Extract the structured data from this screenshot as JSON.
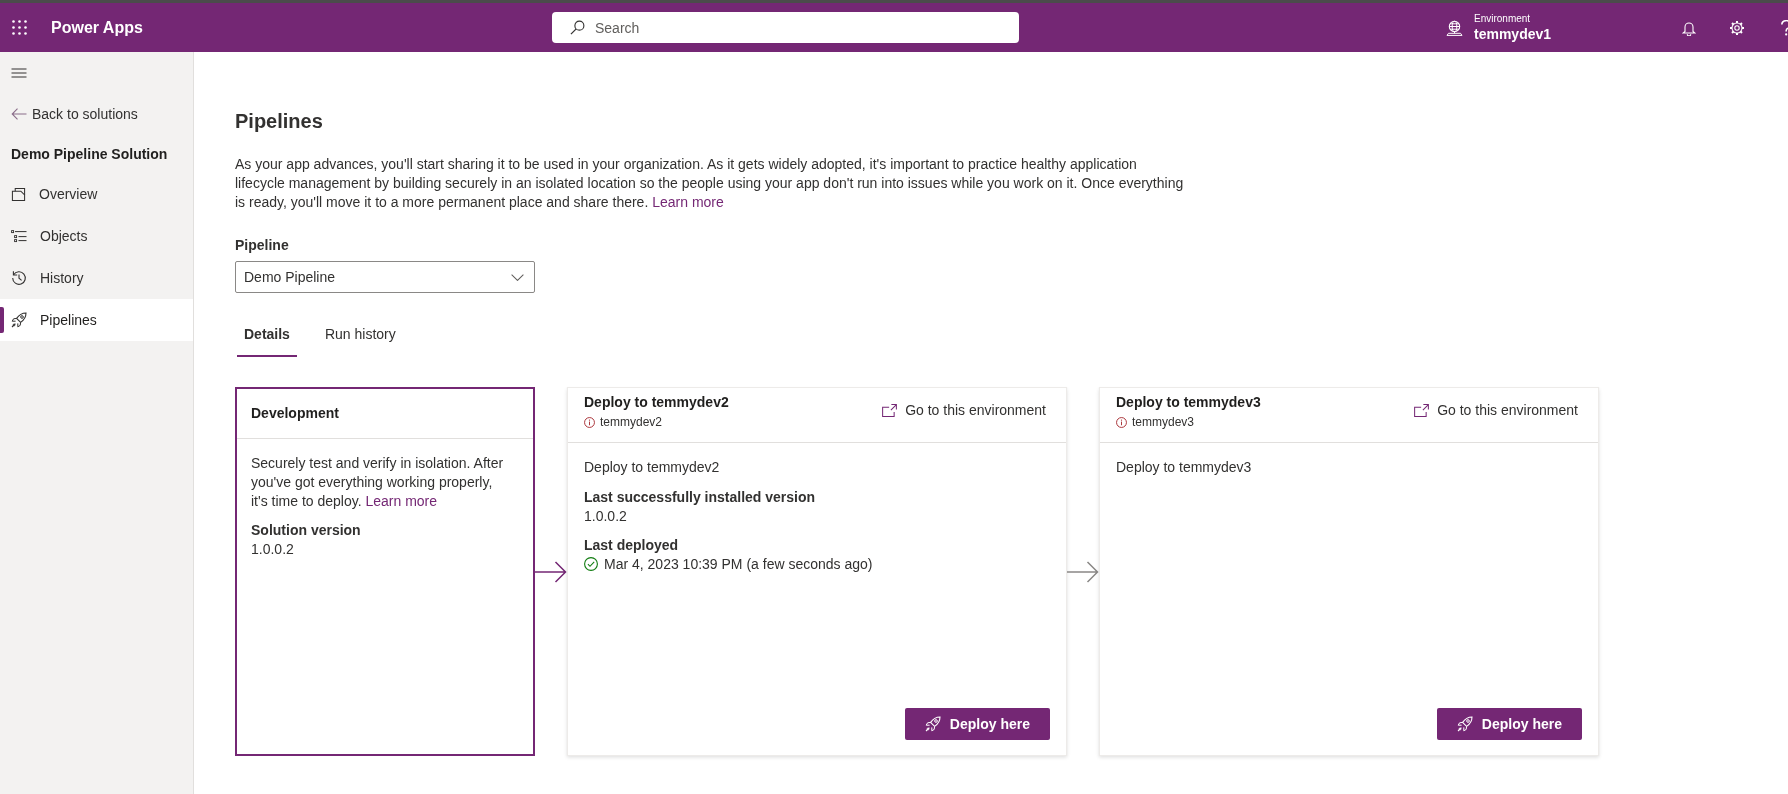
{
  "top_bar": {
    "app_name": "Power Apps",
    "search": {
      "placeholder": "Search"
    },
    "environment": {
      "label": "Environment",
      "name": "temmydev1"
    }
  },
  "sidebar": {
    "back": "Back to solutions",
    "solution_name": "Demo Pipeline Solution",
    "items": [
      {
        "label": "Overview",
        "selected": false
      },
      {
        "label": "Objects",
        "selected": false
      },
      {
        "label": "History",
        "selected": false
      },
      {
        "label": "Pipelines",
        "selected": true
      }
    ]
  },
  "page": {
    "title": "Pipelines",
    "description": {
      "text": "As your app advances, you'll start sharing it to be used in your organization. As it gets widely adopted, it's important to practice healthy application lifecycle management by building securely in an isolated location so the people using your app don't run into issues while you work on it. Once everything is ready, you'll move it to a more permanent place and share there.",
      "link": "Learn more"
    },
    "pipeline": {
      "label": "Pipeline",
      "value": "Demo Pipeline"
    },
    "tabs": [
      {
        "label": "Details",
        "selected": true
      },
      {
        "label": "Run history",
        "selected": false
      }
    ],
    "stages": [
      {
        "kind": "development",
        "selected": true,
        "title": "Development",
        "description": {
          "text": "Securely test and verify in isolation. After you've got everything working properly, it's time to deploy.",
          "link": "Learn more"
        },
        "fields": [
          {
            "label": "Solution version",
            "value": "1.0.0.2"
          }
        ]
      },
      {
        "kind": "deploy",
        "selected": false,
        "deployed": true,
        "title": "Deploy to temmydev2",
        "environment": "temmydev2",
        "go_link": "Go to this environment",
        "description": {
          "text": "Deploy to temmydev2"
        },
        "fields": [
          {
            "label": "Last successfully installed version",
            "value": "1.0.0.2"
          },
          {
            "label": "Last deployed",
            "value": "Mar 4, 2023 10:39 PM (a few seconds ago)",
            "succeeded": true
          }
        ],
        "button": "Deploy here"
      },
      {
        "kind": "deploy",
        "selected": false,
        "deployed": false,
        "title": "Deploy to temmydev3",
        "environment": "temmydev3",
        "go_link": "Go to this environment",
        "description": {
          "text": "Deploy to temmydev3"
        },
        "button": "Deploy here"
      }
    ]
  }
}
